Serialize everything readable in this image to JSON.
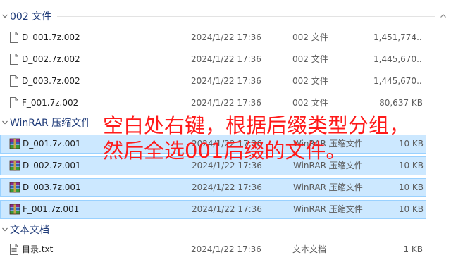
{
  "groups": [
    {
      "title": "002 文件",
      "rows": [
        {
          "name": "D_001.7z.002",
          "date": "2024/1/22 17:36",
          "type": "002 文件",
          "size": "1,451,774...",
          "icon": "blank-file-icon"
        },
        {
          "name": "D_002.7z.002",
          "date": "2024/1/22 17:36",
          "type": "002 文件",
          "size": "1,445,670...",
          "icon": "blank-file-icon"
        },
        {
          "name": "D_003.7z.002",
          "date": "2024/1/22 17:36",
          "type": "002 文件",
          "size": "1,445,670...",
          "icon": "blank-file-icon"
        },
        {
          "name": "F_001.7z.002",
          "date": "2024/1/22 17:36",
          "type": "002 文件",
          "size": "80,637 KB",
          "icon": "blank-file-icon"
        }
      ]
    },
    {
      "title": "WinRAR 压缩文件",
      "rows": [
        {
          "name": "D_001.7z.001",
          "date": "2024/1/22 17:36",
          "type": "WinRAR 压缩文件",
          "size": "10 KB",
          "icon": "winrar-archive-icon"
        },
        {
          "name": "D_002.7z.001",
          "date": "2024/1/22 17:36",
          "type": "WinRAR 压缩文件",
          "size": "10 KB",
          "icon": "winrar-archive-icon"
        },
        {
          "name": "D_003.7z.001",
          "date": "2024/1/22 17:36",
          "type": "WinRAR 压缩文件",
          "size": "10 KB",
          "icon": "winrar-archive-icon"
        },
        {
          "name": "F_001.7z.001",
          "date": "2024/1/22 17:36",
          "type": "WinRAR 压缩文件",
          "size": "10 KB",
          "icon": "winrar-archive-icon"
        }
      ]
    },
    {
      "title": "文本文档",
      "rows": [
        {
          "name": "目录.txt",
          "date": "2024/1/22 17:36",
          "type": "文本文档",
          "size": "1 KB",
          "icon": "text-file-icon"
        }
      ]
    }
  ],
  "annotation": {
    "line1": "空白处右键，根据后缀类型分组，",
    "line2": "然后全选001后缀的文件。",
    "color": "#ff1a1a"
  },
  "colors": {
    "selection_fill": "#cce8ff",
    "selection_border": "#99d1ff",
    "group_title": "#1e3a78"
  }
}
